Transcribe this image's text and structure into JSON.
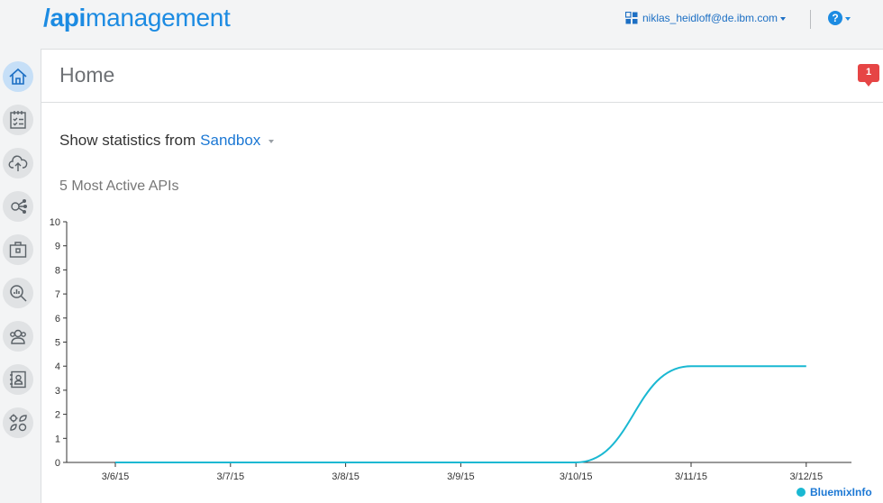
{
  "header": {
    "logo_slash": "/",
    "logo_api": "api",
    "logo_rest": "management",
    "user_email": "niklas_heidloff@de.ibm.com",
    "help_symbol": "?"
  },
  "sidebar": {
    "items": [
      {
        "name": "home",
        "icon": "home-icon",
        "active": true
      },
      {
        "name": "plans",
        "icon": "checklist-icon"
      },
      {
        "name": "cloud",
        "icon": "cloud-upload-icon"
      },
      {
        "name": "apis",
        "icon": "api-nodes-icon"
      },
      {
        "name": "developers",
        "icon": "briefcase-icon"
      },
      {
        "name": "analytics",
        "icon": "analytics-search-icon"
      },
      {
        "name": "users",
        "icon": "users-icon"
      },
      {
        "name": "contacts",
        "icon": "address-book-icon"
      },
      {
        "name": "settings",
        "icon": "settings-leaf-icon"
      }
    ]
  },
  "page": {
    "title": "Home",
    "notification_count": "1",
    "stats_label": "Show statistics from",
    "environment": "Sandbox",
    "section_title": "5 Most Active APIs"
  },
  "colors": {
    "brand": "#1c8be2",
    "series": "#1ab8d2",
    "notification": "#e64545"
  },
  "chart_data": {
    "type": "line",
    "categories": [
      "3/6/15",
      "3/7/15",
      "3/8/15",
      "3/9/15",
      "3/10/15",
      "3/11/15",
      "3/12/15"
    ],
    "series": [
      {
        "name": "BluemixInfo",
        "values": [
          0,
          0,
          0,
          0,
          0,
          4,
          4
        ]
      }
    ],
    "ylim": [
      0,
      10
    ],
    "yticks": [
      0,
      1,
      2,
      3,
      4,
      5,
      6,
      7,
      8,
      9,
      10
    ],
    "legend_position": "bottom-right",
    "grid": false
  }
}
